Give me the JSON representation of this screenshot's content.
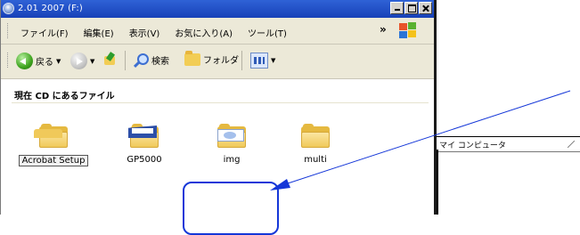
{
  "window": {
    "title": "2.01 2007 (F:)"
  },
  "menubar": {
    "items": [
      "ファイル(F)",
      "編集(E)",
      "表示(V)",
      "お気に入り(A)",
      "ツール(T)"
    ],
    "overflow": "»"
  },
  "toolbar": {
    "back_label": "戻る",
    "search_label": "検索",
    "folders_label": "フォルダ"
  },
  "content": {
    "section_title": "現在 CD にあるファイル",
    "folders": [
      {
        "name": "Acrobat Setup"
      },
      {
        "name": "GP5000"
      },
      {
        "name": "img"
      },
      {
        "name": "multi"
      }
    ]
  },
  "side_panel": {
    "label": "マイ コンピュータ"
  },
  "colors": {
    "title_bar": "#1d4fc4",
    "annotation": "#1537d8",
    "folder": "#e5b940"
  }
}
